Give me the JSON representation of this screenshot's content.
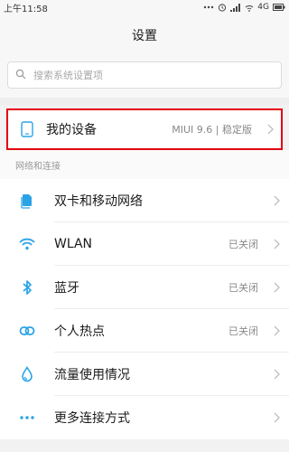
{
  "status_bar": {
    "time": "上午11:58",
    "network": "4G"
  },
  "header": {
    "title": "设置"
  },
  "search": {
    "placeholder": "搜索系统设置项"
  },
  "device": {
    "label": "我的设备",
    "value": "MIUI 9.6 | 稳定版",
    "highlight_color": "#e3000f"
  },
  "section": {
    "label": "网络和连接"
  },
  "items": [
    {
      "label": "双卡和移动网络",
      "value": "",
      "icon": "sim-card-icon"
    },
    {
      "label": "WLAN",
      "value": "已关闭",
      "icon": "wifi-icon"
    },
    {
      "label": "蓝牙",
      "value": "已关闭",
      "icon": "bluetooth-icon"
    },
    {
      "label": "个人热点",
      "value": "已关闭",
      "icon": "hotspot-icon"
    },
    {
      "label": "流量使用情况",
      "value": "",
      "icon": "data-usage-icon"
    },
    {
      "label": "更多连接方式",
      "value": "",
      "icon": "more-icon"
    }
  ],
  "colors": {
    "accent": "#2aa3e6",
    "background": "#f2f2f2"
  }
}
